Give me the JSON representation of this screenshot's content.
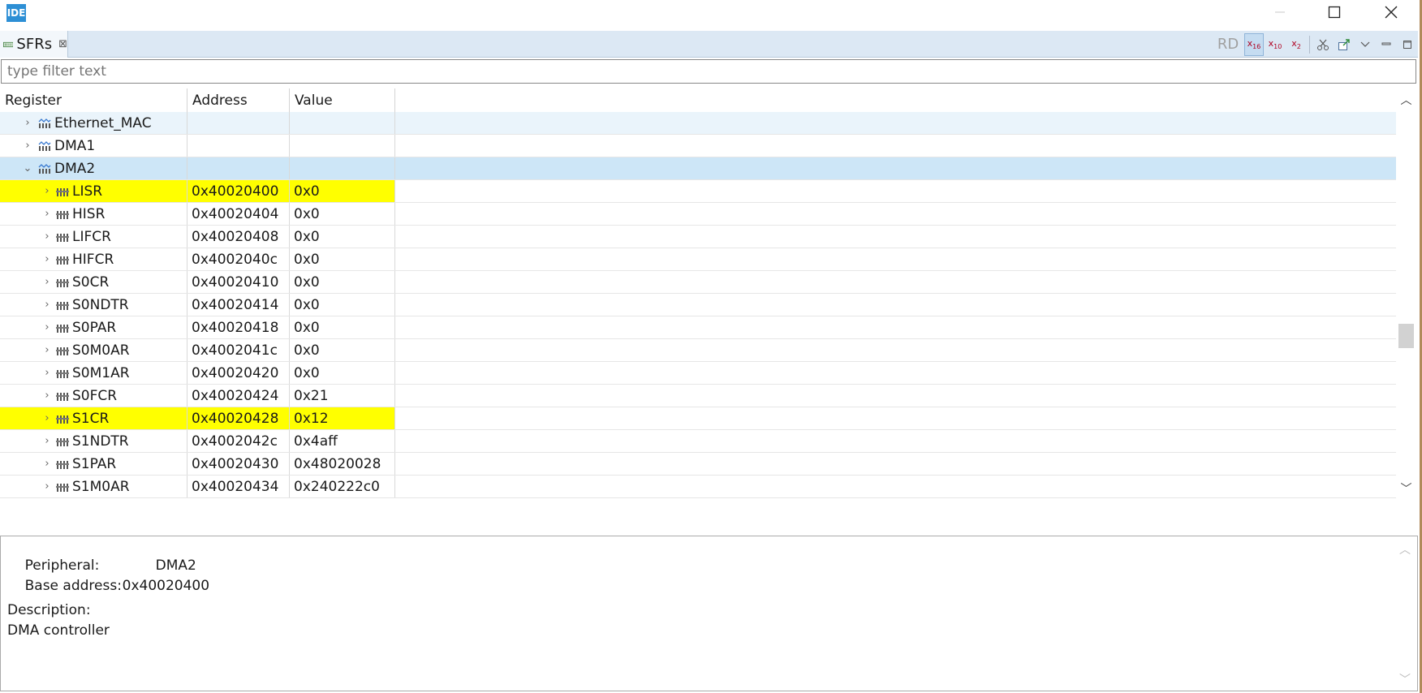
{
  "window": {
    "app_icon_text": "IDE"
  },
  "tab": {
    "label": "SFRs",
    "close": "⊠"
  },
  "toolbar": {
    "rd_label": "RD",
    "hex_label": "x16",
    "dec_label": "x10",
    "bin_label": "x2"
  },
  "filter": {
    "placeholder": "type filter text"
  },
  "columns": {
    "register": "Register",
    "address": "Address",
    "value": "Value"
  },
  "rows": [
    {
      "level": 0,
      "expanded": false,
      "name": "Ethernet_MAC",
      "address": "",
      "value": "",
      "style": "alt"
    },
    {
      "level": 0,
      "expanded": false,
      "name": "DMA1",
      "address": "",
      "value": "",
      "style": ""
    },
    {
      "level": 0,
      "expanded": true,
      "name": "DMA2",
      "address": "",
      "value": "",
      "style": "sel"
    },
    {
      "level": 1,
      "expanded": false,
      "name": "LISR",
      "address": "0x40020400",
      "value": "0x0",
      "style": "hl"
    },
    {
      "level": 1,
      "expanded": false,
      "name": "HISR",
      "address": "0x40020404",
      "value": "0x0",
      "style": ""
    },
    {
      "level": 1,
      "expanded": false,
      "name": "LIFCR",
      "address": "0x40020408",
      "value": "0x0",
      "style": ""
    },
    {
      "level": 1,
      "expanded": false,
      "name": "HIFCR",
      "address": "0x4002040c",
      "value": "0x0",
      "style": ""
    },
    {
      "level": 1,
      "expanded": false,
      "name": "S0CR",
      "address": "0x40020410",
      "value": "0x0",
      "style": ""
    },
    {
      "level": 1,
      "expanded": false,
      "name": "S0NDTR",
      "address": "0x40020414",
      "value": "0x0",
      "style": ""
    },
    {
      "level": 1,
      "expanded": false,
      "name": "S0PAR",
      "address": "0x40020418",
      "value": "0x0",
      "style": ""
    },
    {
      "level": 1,
      "expanded": false,
      "name": "S0M0AR",
      "address": "0x4002041c",
      "value": "0x0",
      "style": ""
    },
    {
      "level": 1,
      "expanded": false,
      "name": "S0M1AR",
      "address": "0x40020420",
      "value": "0x0",
      "style": ""
    },
    {
      "level": 1,
      "expanded": false,
      "name": "S0FCR",
      "address": "0x40020424",
      "value": "0x21",
      "style": ""
    },
    {
      "level": 1,
      "expanded": false,
      "name": "S1CR",
      "address": "0x40020428",
      "value": "0x12",
      "style": "hl"
    },
    {
      "level": 1,
      "expanded": false,
      "name": "S1NDTR",
      "address": "0x4002042c",
      "value": "0x4aff",
      "style": ""
    },
    {
      "level": 1,
      "expanded": false,
      "name": "S1PAR",
      "address": "0x40020430",
      "value": "0x48020028",
      "style": ""
    },
    {
      "level": 1,
      "expanded": false,
      "name": "S1M0AR",
      "address": "0x40020434",
      "value": "0x240222c0",
      "style": ""
    }
  ],
  "detail": {
    "peripheral_label": "Peripheral:",
    "peripheral_value": "DMA2",
    "base_label": "Base address:",
    "base_value": "0x40020400",
    "description_label": "Description:",
    "description_value": "DMA controller"
  },
  "colors": {
    "highlight": "#ffff00",
    "selection": "#cde6f7",
    "alt_row": "#eaf4fb",
    "tab_bar": "#dce8f4"
  }
}
